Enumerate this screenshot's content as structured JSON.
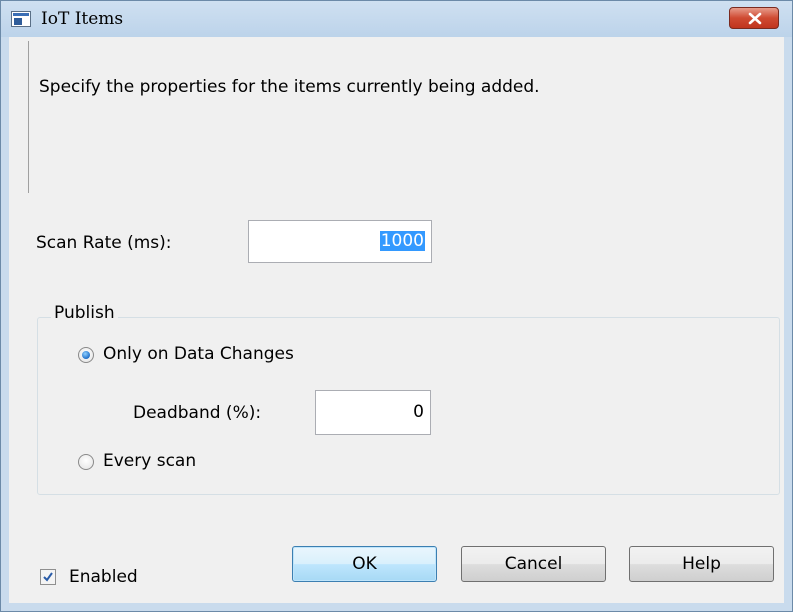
{
  "window": {
    "title": "IoT Items",
    "close_symbol": "✕"
  },
  "description": "Specify the properties for the items currently being added.",
  "scan_rate": {
    "label": "Scan Rate (ms):",
    "value": "1000"
  },
  "publish": {
    "caption": "Publish",
    "options": [
      {
        "label": "Only on Data Changes",
        "selected": true
      },
      {
        "label": "Every scan",
        "selected": false
      }
    ],
    "deadband": {
      "label": "Deadband (%):",
      "value": "0"
    }
  },
  "enabled": {
    "label": "Enabled",
    "checked": true
  },
  "buttons": {
    "ok": "OK",
    "cancel": "Cancel",
    "help": "Help"
  },
  "icons": {
    "app": "window-app-icon",
    "close": "close-icon",
    "check": "checkmark-icon"
  }
}
